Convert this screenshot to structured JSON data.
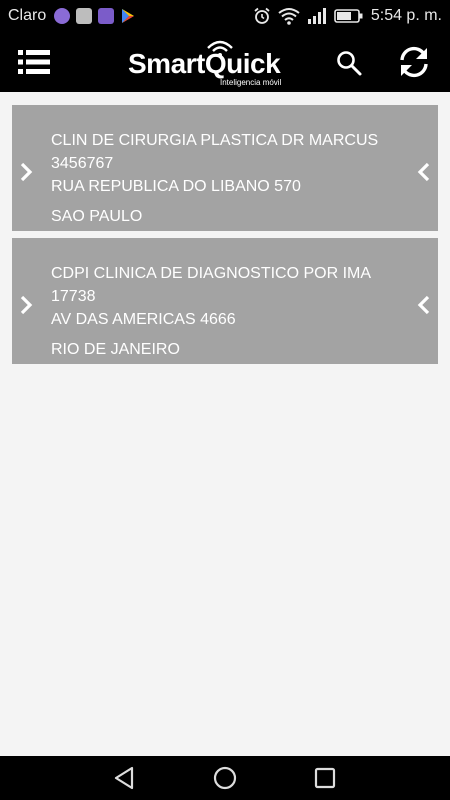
{
  "status_bar": {
    "carrier": "Claro",
    "time": "5:54 p. m.",
    "icons": [
      "messenger-icon",
      "image-icon",
      "gallery-icon",
      "play-store-icon",
      "alarm-icon",
      "wifi-icon",
      "signal-icon",
      "battery-icon"
    ]
  },
  "app_bar": {
    "logo_text": "SmartQuick",
    "logo_sub": "Inteligencia móvil",
    "icons": [
      "menu-icon",
      "search-icon",
      "refresh-icon"
    ]
  },
  "clinics": [
    {
      "name": "CLIN DE CIRURGIA PLASTICA DR MARCUS",
      "code": "3456767",
      "address": "RUA REPUBLICA DO LIBANO 570",
      "city": "SAO PAULO"
    },
    {
      "name": "CDPI CLINICA DE DIAGNOSTICO POR IMA",
      "code": "17738",
      "address": "AV DAS AMERICAS 4666",
      "city": "RIO DE JANEIRO"
    }
  ],
  "nav_bar": {
    "icons": [
      "back-icon",
      "home-icon",
      "recent-apps-icon"
    ]
  },
  "colors": {
    "bar_background": "#000000",
    "card_background": "#a3a3a3",
    "page_background": "#f4f4f4"
  }
}
